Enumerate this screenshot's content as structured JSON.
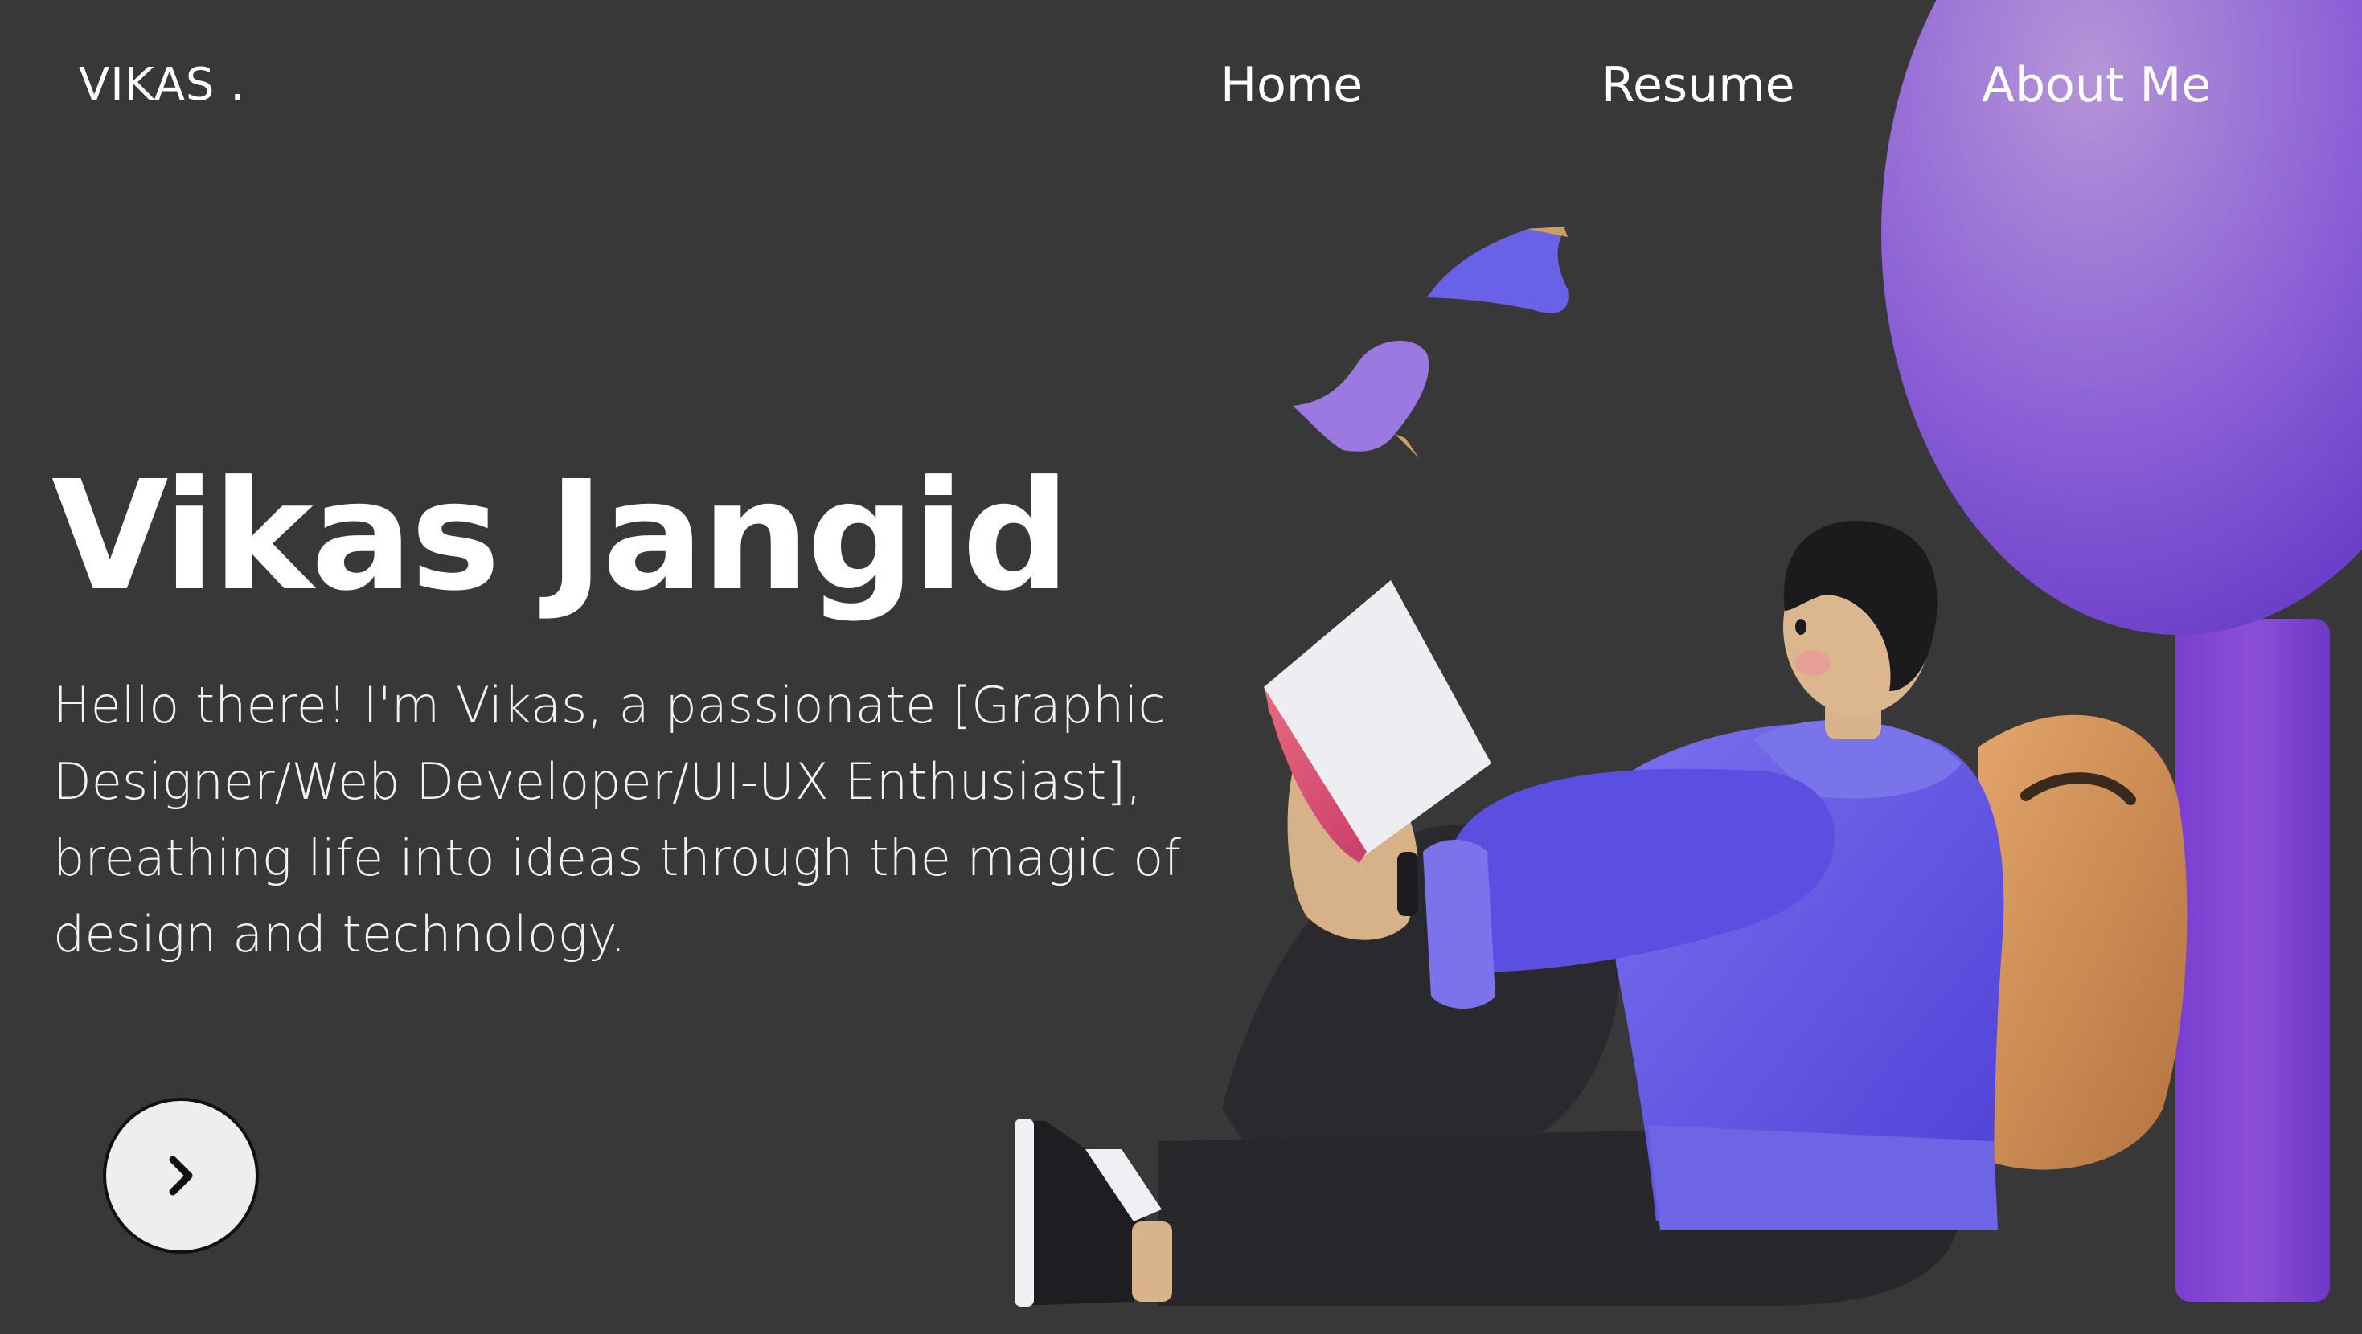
{
  "header": {
    "logo": "VIKAS .",
    "nav": [
      {
        "label": "Home"
      },
      {
        "label": "Resume"
      },
      {
        "label": "About Me"
      }
    ]
  },
  "hero": {
    "title": "Vikas Jangid",
    "description": "Hello there! I'm Vikas, a passionate [Graphic Designer/Web Developer/UI-UX Enthusiast], breathing life into ideas through the magic of design and technology."
  },
  "next_button": {
    "icon": "chevron-right-icon"
  },
  "colors": {
    "background": "#383838",
    "text": "#ffffff",
    "accent_purple": "#8b5be0",
    "hoodie": "#5a4fe0",
    "backpack": "#c98a54"
  }
}
